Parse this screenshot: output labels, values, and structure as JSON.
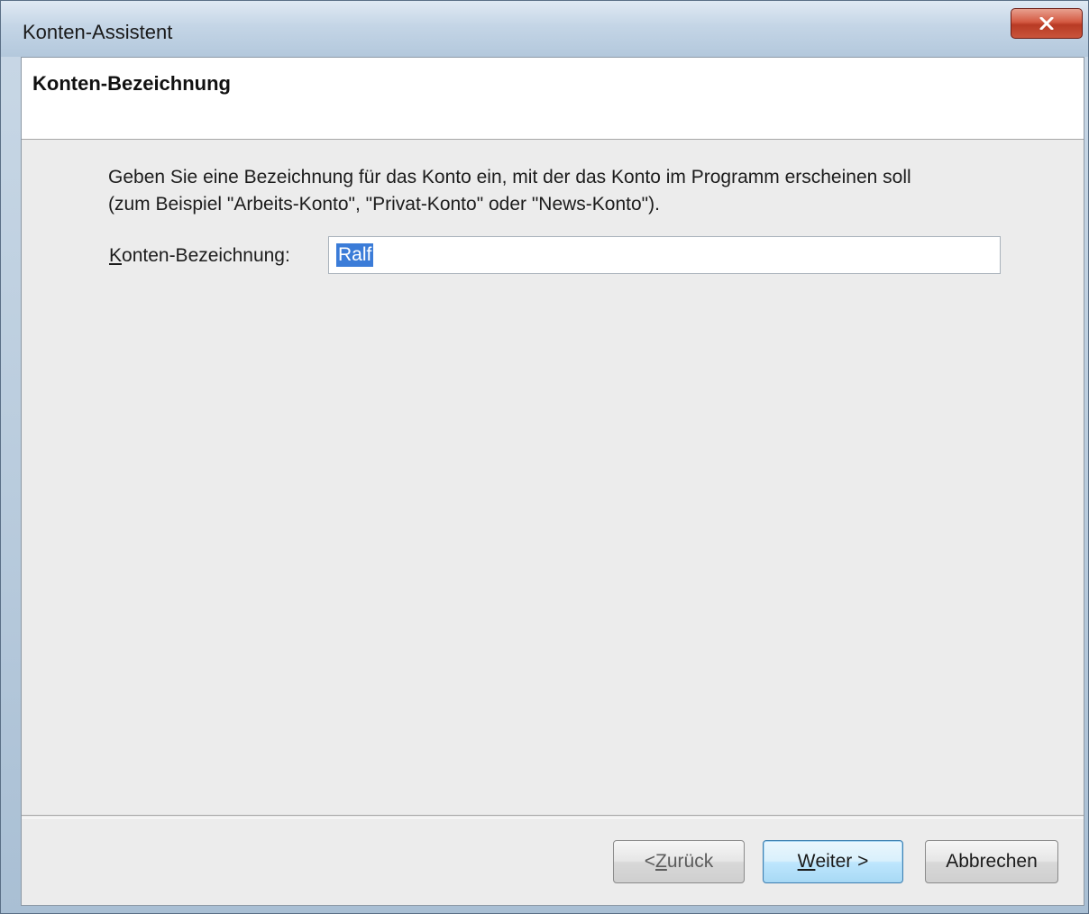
{
  "window": {
    "title": "Konten-Assistent",
    "close_icon": "close-icon"
  },
  "page": {
    "heading": "Konten-Bezeichnung",
    "description_line1": "Geben Sie eine Bezeichnung für das Konto ein, mit der das Konto im Programm erscheinen soll",
    "description_line2": "(zum Beispiel \"Arbeits-Konto\", \"Privat-Konto\" oder \"News-Konto\")."
  },
  "field": {
    "label_first": "K",
    "label_rest": "onten-Bezeichnung:",
    "value": "Ralf"
  },
  "buttons": {
    "back_prefix": "< ",
    "back_mnemonic": "Z",
    "back_rest": "urück",
    "next_mnemonic": "W",
    "next_rest": "eiter >",
    "cancel_label": "Abbrechen"
  },
  "colors": {
    "selection": "#3b7cd8",
    "close_button": "#c9553c",
    "default_button_border": "#3c7fb1"
  }
}
